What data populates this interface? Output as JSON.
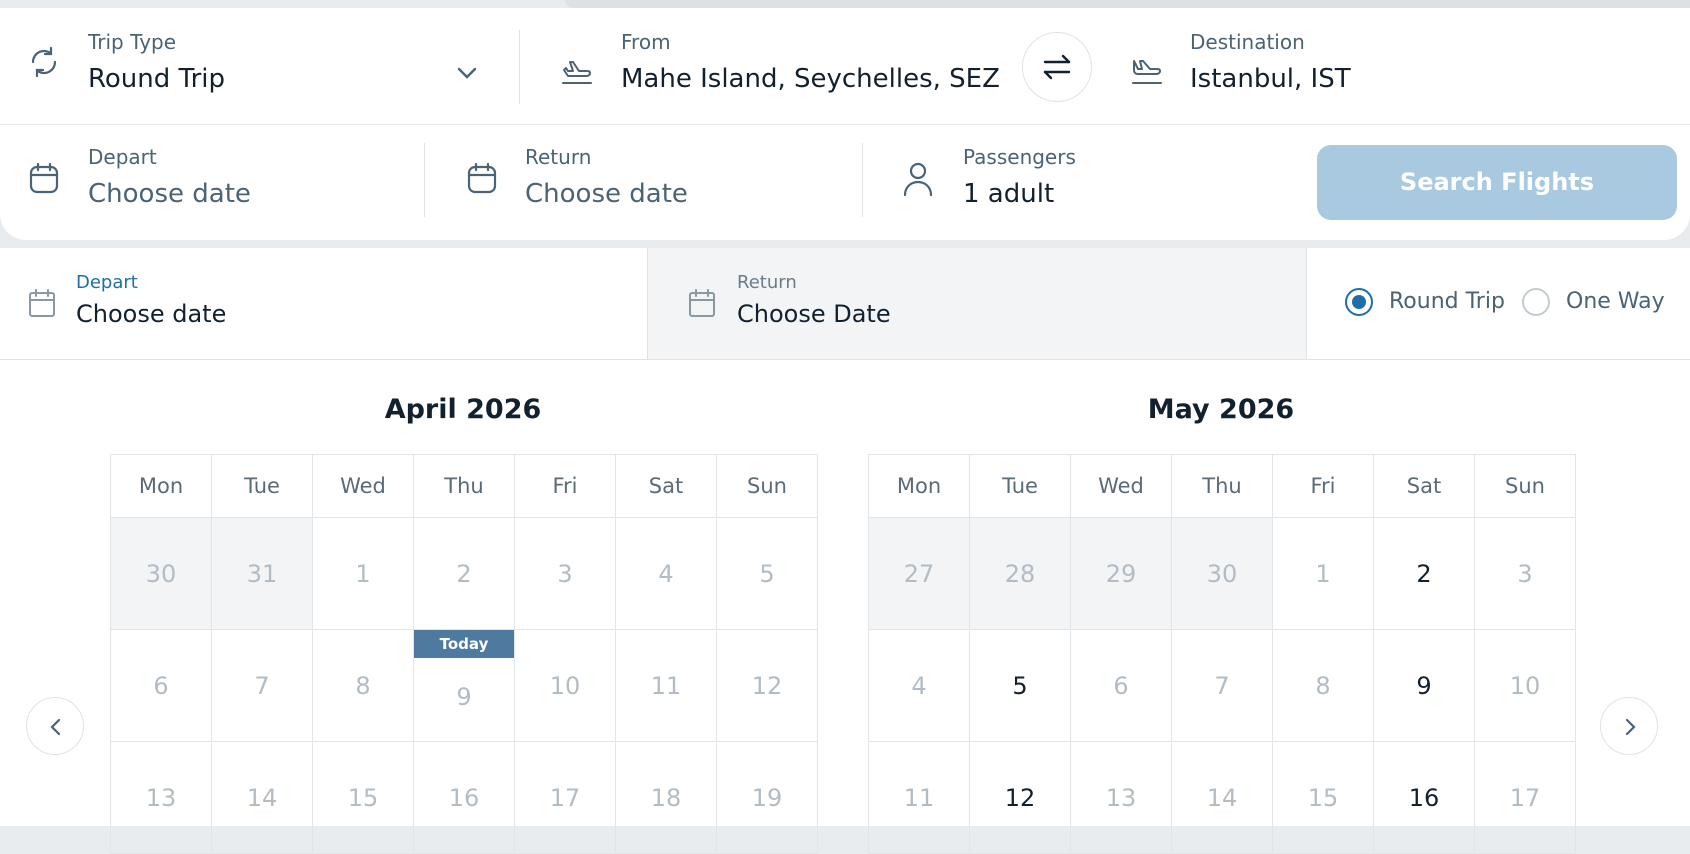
{
  "search": {
    "trip_type": {
      "label": "Trip Type",
      "value": "Round Trip"
    },
    "from": {
      "label": "From",
      "value": "Mahe Island, Seychelles, SEZ"
    },
    "destination": {
      "label": "Destination",
      "value": "Istanbul, IST"
    },
    "depart": {
      "label": "Depart",
      "value": "Choose date"
    },
    "return": {
      "label": "Return",
      "value": "Choose date"
    },
    "passengers": {
      "label": "Passengers",
      "value": "1 adult"
    },
    "search_button": "Search Flights"
  },
  "picker": {
    "depart_tab": {
      "label": "Depart",
      "value": "Choose date"
    },
    "return_tab": {
      "label": "Return",
      "value": "Choose Date"
    },
    "trip_options": [
      {
        "label": "Round Trip",
        "selected": true
      },
      {
        "label": "One Way",
        "selected": false
      }
    ],
    "weekdays": [
      "Mon",
      "Tue",
      "Wed",
      "Thu",
      "Fri",
      "Sat",
      "Sun"
    ],
    "today_label": "Today",
    "months": [
      {
        "title": "April 2026",
        "rows": [
          [
            {
              "d": "30",
              "s": "grey"
            },
            {
              "d": "31",
              "s": "grey"
            },
            {
              "d": "1",
              "s": "dis"
            },
            {
              "d": "2",
              "s": "dis"
            },
            {
              "d": "3",
              "s": "dis"
            },
            {
              "d": "4",
              "s": "dis"
            },
            {
              "d": "5",
              "s": "dis"
            }
          ],
          [
            {
              "d": "6",
              "s": "dis"
            },
            {
              "d": "7",
              "s": "dis"
            },
            {
              "d": "8",
              "s": "dis"
            },
            {
              "d": "9",
              "s": "today"
            },
            {
              "d": "10",
              "s": "dis"
            },
            {
              "d": "11",
              "s": "dis"
            },
            {
              "d": "12",
              "s": "dis"
            }
          ],
          [
            {
              "d": "13",
              "s": "dis"
            },
            {
              "d": "14",
              "s": "dis"
            },
            {
              "d": "15",
              "s": "dis"
            },
            {
              "d": "16",
              "s": "dis"
            },
            {
              "d": "17",
              "s": "dis"
            },
            {
              "d": "18",
              "s": "dis"
            },
            {
              "d": "19",
              "s": "dis"
            }
          ]
        ]
      },
      {
        "title": "May 2026",
        "rows": [
          [
            {
              "d": "27",
              "s": "grey"
            },
            {
              "d": "28",
              "s": "grey"
            },
            {
              "d": "29",
              "s": "grey"
            },
            {
              "d": "30",
              "s": "grey"
            },
            {
              "d": "1",
              "s": "dis"
            },
            {
              "d": "2",
              "s": "avail"
            },
            {
              "d": "3",
              "s": "dis"
            }
          ],
          [
            {
              "d": "4",
              "s": "dis"
            },
            {
              "d": "5",
              "s": "avail"
            },
            {
              "d": "6",
              "s": "dis"
            },
            {
              "d": "7",
              "s": "dis"
            },
            {
              "d": "8",
              "s": "dis"
            },
            {
              "d": "9",
              "s": "avail"
            },
            {
              "d": "10",
              "s": "dis"
            }
          ],
          [
            {
              "d": "11",
              "s": "dis"
            },
            {
              "d": "12",
              "s": "avail"
            },
            {
              "d": "13",
              "s": "dis"
            },
            {
              "d": "14",
              "s": "dis"
            },
            {
              "d": "15",
              "s": "dis"
            },
            {
              "d": "16",
              "s": "avail"
            },
            {
              "d": "17",
              "s": "dis"
            }
          ]
        ]
      }
    ]
  },
  "colors": {
    "accent": "#1d6fa5",
    "search_button_bg": "#a9c9e0",
    "today_badge": "#4e7aa0",
    "depart_tab_label": "#1d6fa5",
    "muted_text": "#4b6375"
  },
  "icons": {
    "trip_type": "refresh-icon",
    "dropdown": "chevron-down-icon",
    "from": "plane-takeoff-icon",
    "swap": "swap-arrows-icon",
    "destination": "plane-landing-icon",
    "depart": "calendar-icon",
    "return": "calendar-icon",
    "passengers": "person-icon",
    "prev": "chevron-left-icon",
    "next": "chevron-right-icon"
  }
}
